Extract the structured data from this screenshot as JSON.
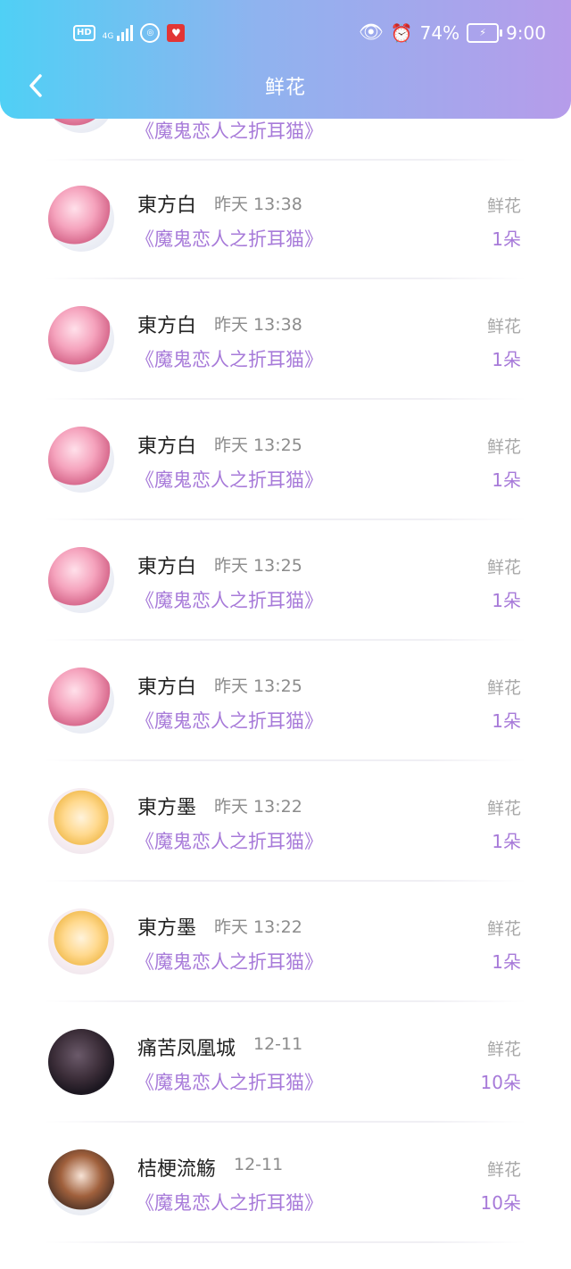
{
  "status_bar": {
    "hd": "HD",
    "network": "4G",
    "battery_percent": "74%",
    "time": "9:00"
  },
  "header": {
    "title": "鲜花"
  },
  "partial_row": {
    "book": "《魔鬼恋人之折耳猫》"
  },
  "records": [
    {
      "name": "東方白",
      "time": "昨天 13:38",
      "book": "《魔鬼恋人之折耳猫》",
      "gift": "鲜花",
      "count": "1朵",
      "avatar": "pink"
    },
    {
      "name": "東方白",
      "time": "昨天 13:38",
      "book": "《魔鬼恋人之折耳猫》",
      "gift": "鲜花",
      "count": "1朵",
      "avatar": "pink"
    },
    {
      "name": "東方白",
      "time": "昨天 13:25",
      "book": "《魔鬼恋人之折耳猫》",
      "gift": "鲜花",
      "count": "1朵",
      "avatar": "pink"
    },
    {
      "name": "東方白",
      "time": "昨天 13:25",
      "book": "《魔鬼恋人之折耳猫》",
      "gift": "鲜花",
      "count": "1朵",
      "avatar": "pink"
    },
    {
      "name": "東方白",
      "time": "昨天 13:25",
      "book": "《魔鬼恋人之折耳猫》",
      "gift": "鲜花",
      "count": "1朵",
      "avatar": "pink"
    },
    {
      "name": "東方墨",
      "time": "昨天 13:22",
      "book": "《魔鬼恋人之折耳猫》",
      "gift": "鲜花",
      "count": "1朵",
      "avatar": "blonde"
    },
    {
      "name": "東方墨",
      "time": "昨天 13:22",
      "book": "《魔鬼恋人之折耳猫》",
      "gift": "鲜花",
      "count": "1朵",
      "avatar": "blonde"
    },
    {
      "name": "痛苦凤凰城",
      "time": "12-11",
      "book": "《魔鬼恋人之折耳猫》",
      "gift": "鲜花",
      "count": "10朵",
      "avatar": "dark"
    },
    {
      "name": "桔梗流觞",
      "time": "12-11",
      "book": "《魔鬼恋人之折耳猫》",
      "gift": "鲜花",
      "count": "10朵",
      "avatar": "brown"
    }
  ],
  "colors": {
    "header_start": "#4fd0f5",
    "header_end": "#b69cea",
    "accent_purple": "#a77ad9"
  }
}
